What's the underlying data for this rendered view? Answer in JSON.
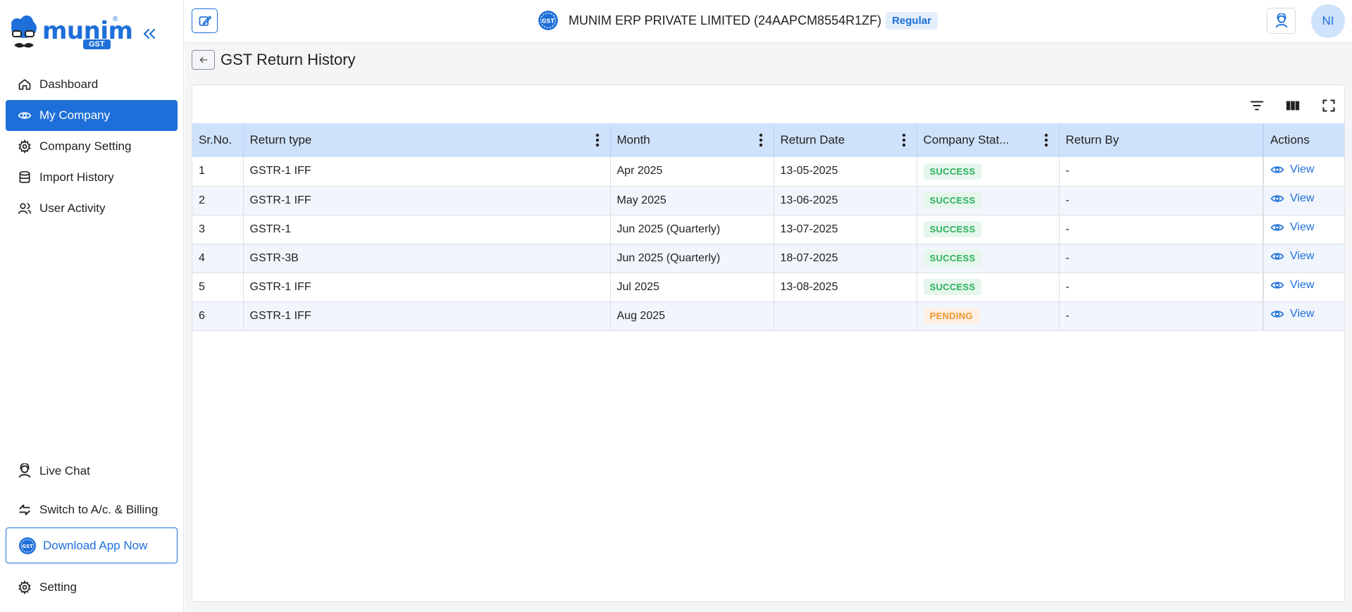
{
  "app": {
    "logo_text": "munim",
    "logo_badge": "GST",
    "logo_reg": "®"
  },
  "sidebar": {
    "items": [
      {
        "label": "Dashboard",
        "icon": "home-icon",
        "active": false
      },
      {
        "label": "My Company",
        "icon": "eye-icon",
        "active": true
      },
      {
        "label": "Company Setting",
        "icon": "gear-icon",
        "active": false
      },
      {
        "label": "Import History",
        "icon": "database-icon",
        "active": false
      },
      {
        "label": "User Activity",
        "icon": "users-icon",
        "active": false
      }
    ],
    "live_chat": "Live Chat",
    "switch_billing": "Switch to A/c. & Billing",
    "download_app": "Download App Now",
    "setting": "Setting"
  },
  "header": {
    "company_name": "MUNIM ERP PRIVATE LIMITED (24AAPCM8554R1ZF)",
    "company_type": "Regular",
    "logo_badge": "GST",
    "avatar_initials": "NI"
  },
  "page": {
    "title": "GST Return History"
  },
  "table": {
    "columns": [
      "Sr.No.",
      "Return type",
      "Month",
      "Return Date",
      "Company Stat...",
      "Return By",
      "Actions"
    ],
    "rows": [
      {
        "sr": "1",
        "type": "GSTR-1 IFF",
        "month": "Apr 2025",
        "date": "13-05-2025",
        "status": "SUCCESS",
        "by": "-",
        "action": "View"
      },
      {
        "sr": "2",
        "type": "GSTR-1 IFF",
        "month": "May 2025",
        "date": "13-06-2025",
        "status": "SUCCESS",
        "by": "-",
        "action": "View"
      },
      {
        "sr": "3",
        "type": "GSTR-1",
        "month": "Jun 2025 (Quarterly)",
        "date": "13-07-2025",
        "status": "SUCCESS",
        "by": "-",
        "action": "View"
      },
      {
        "sr": "4",
        "type": "GSTR-3B",
        "month": "Jun 2025 (Quarterly)",
        "date": "18-07-2025",
        "status": "SUCCESS",
        "by": "-",
        "action": "View"
      },
      {
        "sr": "5",
        "type": "GSTR-1 IFF",
        "month": "Jul 2025",
        "date": "13-08-2025",
        "status": "SUCCESS",
        "by": "-",
        "action": "View"
      },
      {
        "sr": "6",
        "type": "GSTR-1 IFF",
        "month": "Aug 2025",
        "date": "",
        "status": "PENDING",
        "by": "-",
        "action": "View"
      }
    ]
  },
  "colors": {
    "accent": "#1e6fd9",
    "success": "#2bb15b",
    "pending": "#f0972f",
    "header_row": "#cfe2fb"
  }
}
